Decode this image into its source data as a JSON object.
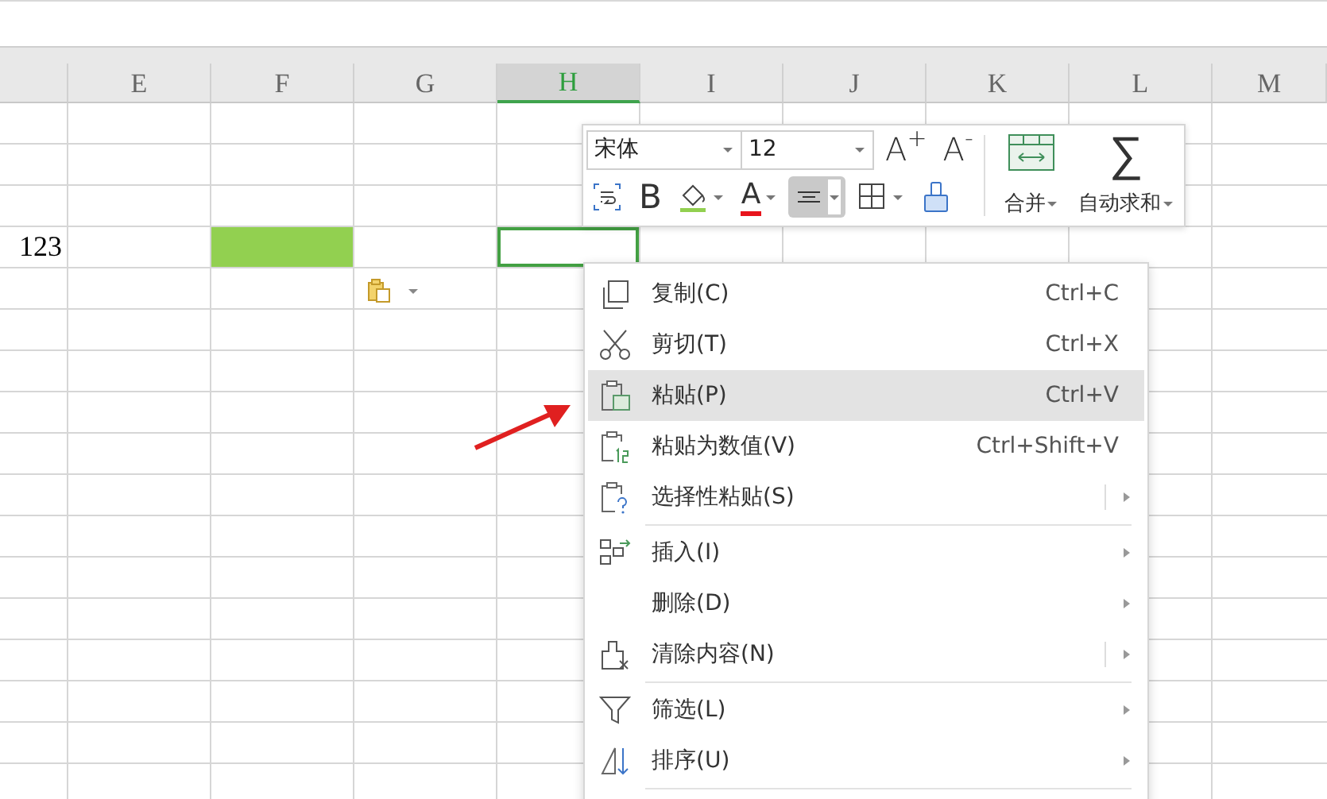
{
  "sheet": {
    "columns": [
      {
        "selected": false
      },
      {
        "label": "E",
        "selected": false
      },
      {
        "label": "F",
        "selected": false
      },
      {
        "label": "G",
        "selected": false
      },
      {
        "label": "H",
        "selected": true
      },
      {
        "label": "I",
        "selected": false
      },
      {
        "label": "J",
        "selected": false
      },
      {
        "label": "K",
        "selected": false
      },
      {
        "label": "L",
        "selected": false
      },
      {
        "label": "M",
        "selected": false
      }
    ],
    "rows": [
      {},
      {},
      {},
      {
        "cells": [
          {
            "text": "123"
          },
          {},
          {
            "color": "#92d050"
          },
          {},
          {
            "selected": true
          },
          {},
          {},
          {},
          {},
          {}
        ]
      },
      {},
      {},
      {},
      {},
      {},
      {},
      {},
      {},
      {},
      {},
      {},
      {},
      {}
    ]
  },
  "mini_toolbar": {
    "font": {
      "value": "宋体"
    },
    "size": {
      "value": "12"
    },
    "grow_font": "A$^{+}$",
    "shrink_font": "A$^{-}$",
    "tools": [
      {
        "kind": "wrap",
        "selected": false,
        "dropdown": false
      },
      {
        "kind": "bold",
        "label": "B",
        "selected": false,
        "dropdown": false
      },
      {
        "kind": "fill",
        "selected": false,
        "dropdown": true
      },
      {
        "kind": "fontcolor",
        "label": "A",
        "selected": false,
        "dropdown": true
      },
      {
        "kind": "align",
        "selected": true,
        "dropdown": true
      },
      {
        "kind": "border",
        "selected": false,
        "dropdown": true
      },
      {
        "kind": "painter",
        "selected": false,
        "dropdown": false
      }
    ],
    "merge": {
      "label": "合并"
    },
    "autosum": {
      "label": "自动求和",
      "symbol": "∑"
    }
  },
  "context_menu": [
    {
      "kind": "item",
      "label": "复制(C)",
      "shortcut": "Ctrl+C",
      "selected": false,
      "submenu": false,
      "split": false
    },
    {
      "kind": "item",
      "label": "剪切(T)",
      "shortcut": "Ctrl+X",
      "selected": false,
      "submenu": false,
      "split": false
    },
    {
      "kind": "item",
      "label": "粘贴(P)",
      "shortcut": "Ctrl+V",
      "selected": true,
      "submenu": false,
      "split": false
    },
    {
      "kind": "item",
      "label": "粘贴为数值(V)",
      "shortcut": "Ctrl+Shift+V",
      "selected": false,
      "submenu": false,
      "split": false
    },
    {
      "kind": "item",
      "label": "选择性粘贴(S)",
      "selected": false,
      "submenu": true,
      "split": true
    },
    {
      "kind": "separator"
    },
    {
      "kind": "item",
      "label": "插入(I)",
      "selected": false,
      "submenu": true,
      "split": false
    },
    {
      "kind": "item",
      "label": "删除(D)",
      "selected": false,
      "submenu": true,
      "split": false
    },
    {
      "kind": "item",
      "label": "清除内容(N)",
      "selected": false,
      "submenu": true,
      "split": true
    },
    {
      "kind": "separator"
    },
    {
      "kind": "item",
      "label": "筛选(L)",
      "selected": false,
      "submenu": true,
      "split": false
    },
    {
      "kind": "item",
      "label": "排序(U)",
      "selected": false,
      "submenu": true,
      "split": false
    },
    {
      "kind": "separator"
    }
  ]
}
